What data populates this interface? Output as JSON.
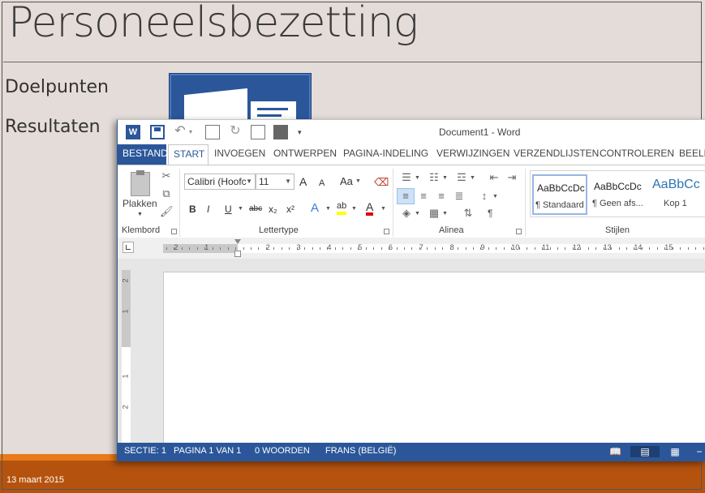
{
  "slide": {
    "title": "Personeelsbezetting",
    "bullets": [
      "Doelpunten",
      "Resultaten"
    ],
    "footer_date": "13 maart 2015"
  },
  "word": {
    "window_title": "Document1 - Word",
    "tabs": [
      {
        "label": "BESTAND"
      },
      {
        "label": "START"
      },
      {
        "label": "INVOEGEN"
      },
      {
        "label": "ONTWERPEN"
      },
      {
        "label": "PAGINA-INDELING"
      },
      {
        "label": "VERWIJZINGEN"
      },
      {
        "label": "VERZENDLIJSTEN"
      },
      {
        "label": "CONTROLEREN"
      },
      {
        "label": "BEELD"
      }
    ],
    "clipboard": {
      "paste_label": "Plakken",
      "group_label": "Klembord"
    },
    "font": {
      "font_name": "Calibri (Hoofc",
      "font_size": "11",
      "group_label": "Lettertype",
      "grow": "A",
      "shrink": "A",
      "case": "Aa",
      "bold": "B",
      "italic": "I",
      "underline": "U",
      "strike": "abc",
      "subscript": "x₂",
      "superscript": "x²",
      "text_effects": "A",
      "highlight": "ab",
      "font_color": "A"
    },
    "paragraph": {
      "group_label": "Alinea",
      "pilcrow": "¶"
    },
    "styles": {
      "group_label": "Stijlen",
      "items": [
        {
          "sample": "AaBbCcDc",
          "name": "¶ Standaard"
        },
        {
          "sample": "AaBbCcDc",
          "name": "¶ Geen afs..."
        },
        {
          "sample": "AaBbCc",
          "name": "Kop 1"
        }
      ]
    },
    "ruler": {
      "numbers": [
        "2",
        "1",
        "1",
        "2",
        "3",
        "4",
        "5",
        "6",
        "7",
        "8",
        "9",
        "10",
        "11",
        "12",
        "13",
        "14",
        "15"
      ],
      "vertical_numbers": [
        "2",
        "1",
        "1",
        "2"
      ]
    },
    "status": {
      "section": "SECTIE: 1",
      "page": "PAGINA 1 VAN 1",
      "words": "0 WOORDEN",
      "language": "FRANS (BELGIË)"
    }
  },
  "colors": {
    "word_blue": "#2b579a",
    "slide_bg": "#e4dcd8",
    "footer_orange": "#b5530e",
    "accent_orange": "#e87a1a"
  }
}
